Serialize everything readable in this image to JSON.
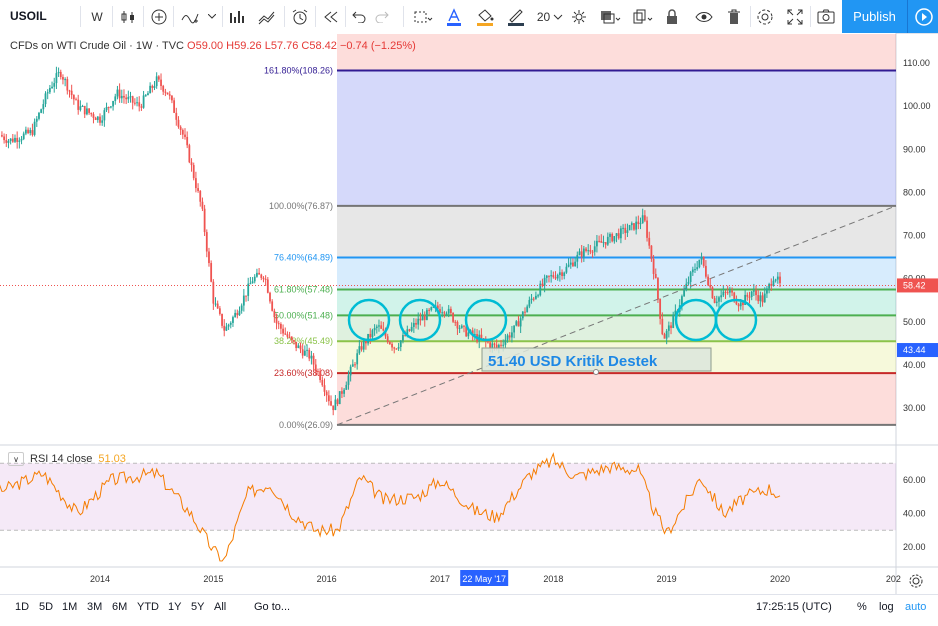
{
  "toolbar": {
    "symbol": "USOIL",
    "interval": "W",
    "size": "20",
    "publish": "Publish"
  },
  "legend": {
    "title": "CFDs on WTI Crude Oil · 1W · TVC",
    "ohlc": "O59.00 H59.26 L57.76 C58.42 −0.74 (−1.25%)"
  },
  "fib": {
    "levels": [
      {
        "label": "161.80%(108.26)",
        "value": 108.26,
        "color": "#311b92"
      },
      {
        "label": "100.00%(76.87)",
        "value": 76.87,
        "color": "#757575"
      },
      {
        "label": "76.40%(64.89)",
        "value": 64.89,
        "color": "#2196f3"
      },
      {
        "label": "61.80%(57.48)",
        "value": 57.48,
        "color": "#4caf50"
      },
      {
        "label": "50.00%(51.48)",
        "value": 51.48,
        "color": "#4caf50"
      },
      {
        "label": "38.20%(45.49)",
        "value": 45.49,
        "color": "#8bc34a"
      },
      {
        "label": "23.60%(38.08)",
        "value": 38.08,
        "color": "#c62828"
      },
      {
        "label": "0.00%(26.09)",
        "value": 26.09,
        "color": "#757575"
      }
    ]
  },
  "annotation": {
    "text": "51.40 USD Kritik Destek"
  },
  "price_axis": {
    "ticks": [
      "110.00",
      "100.00",
      "90.00",
      "80.00",
      "70.00",
      "60.00",
      "50.00",
      "40.00",
      "30.00"
    ],
    "last_price": "58.42",
    "last_price_color": "#ef5350",
    "marker_price": "43.44",
    "marker_color": "#2962ff"
  },
  "time_axis": {
    "ticks": [
      "2014",
      "2015",
      "2016",
      "2017",
      "2018",
      "2019",
      "2020",
      "202"
    ],
    "highlight": "22 May '17"
  },
  "rsi": {
    "label": "RSI 14 close",
    "value": "51.03",
    "ticks": [
      "60.00",
      "40.00",
      "20.00"
    ]
  },
  "bottom": {
    "ranges": [
      "1D",
      "5D",
      "1M",
      "3M",
      "6M",
      "YTD",
      "1Y",
      "5Y",
      "All"
    ],
    "goto": "Go to...",
    "time": "17:25:15 (UTC)",
    "percent": "%",
    "log": "log",
    "auto": "auto"
  }
}
